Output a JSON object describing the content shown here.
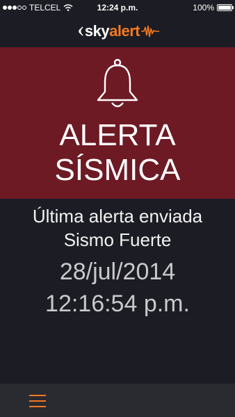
{
  "status_bar": {
    "carrier": "TELCEL",
    "time": "12:24 p.m.",
    "battery": "100%",
    "signal_bars": 3,
    "signal_total": 5,
    "battery_level": 1.0
  },
  "header": {
    "logo_part1": "sky",
    "logo_part2": "alert"
  },
  "alert": {
    "title_line1": "ALERTA",
    "title_line2": "SÍSMICA",
    "icon": "bell-icon"
  },
  "info": {
    "label": "Última alerta enviada",
    "type": "Sismo Fuerte",
    "date": "28/jul/2014",
    "time": "12:16:54 p.m."
  },
  "bottom_bar": {
    "menu_icon": "hamburger-menu-icon"
  },
  "colors": {
    "background": "#1c1c24",
    "alert_banner": "#6d1a25",
    "accent": "#f47920",
    "bottom_bar": "#2a2a31"
  }
}
